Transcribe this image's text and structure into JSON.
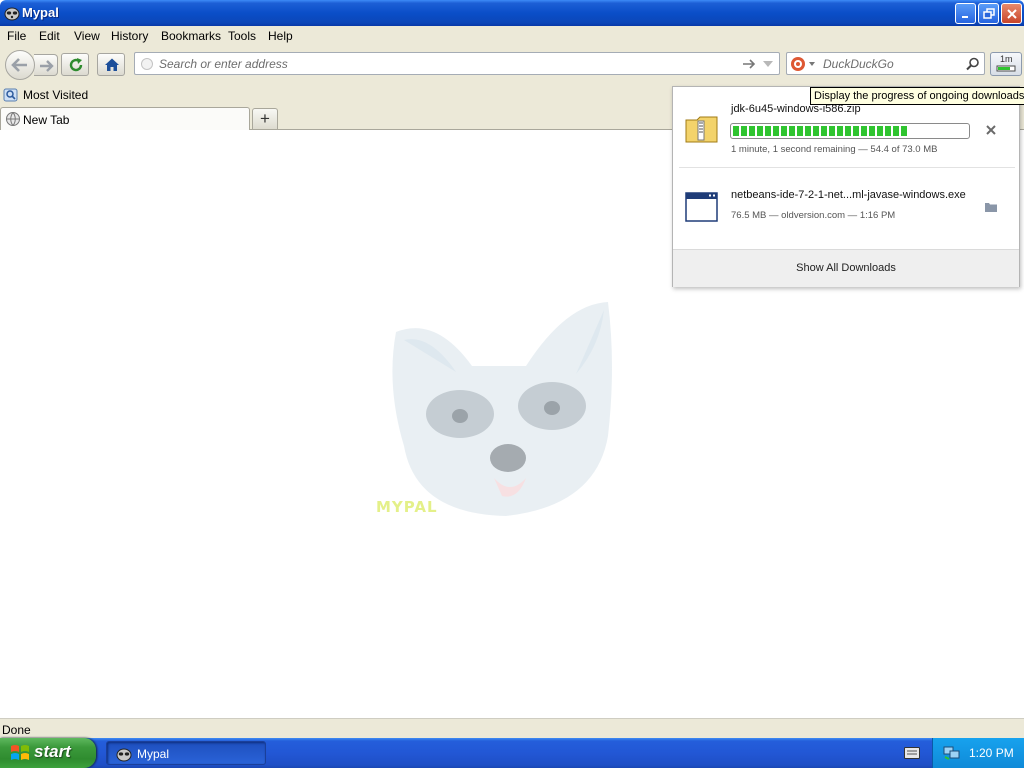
{
  "window": {
    "title": "Mypal"
  },
  "menu": [
    "File",
    "Edit",
    "View",
    "History",
    "Bookmarks",
    "Tools",
    "Help"
  ],
  "navbar": {
    "url_placeholder": "Search or enter address",
    "search_placeholder": "DuckDuckGo",
    "download_time": "1m"
  },
  "bookmarks": [
    {
      "label": "Most Visited"
    }
  ],
  "tabs": [
    {
      "label": "New Tab",
      "active": true
    }
  ],
  "content": {
    "logo_text": "MYPAL"
  },
  "tooltip": "Display the progress of ongoing downloads",
  "downloads": {
    "items": [
      {
        "name": "jdk-6u45-windows-i586.zip",
        "status": "1 minute, 1 second remaining — 54.4 of 73.0 MB",
        "progress": 0.745,
        "icon": "zip-file-icon",
        "action": "cancel"
      },
      {
        "name": "netbeans-ide-7-2-1-net...ml-javase-windows.exe",
        "status": "76.5 MB — oldversion.com — 1:16 PM",
        "icon": "exe-file-icon",
        "action": "open-folder"
      }
    ],
    "show_all_label": "Show All Downloads"
  },
  "statusbar": {
    "text": "Done"
  },
  "taskbar": {
    "start_label": "start",
    "tasks": [
      {
        "label": "Mypal"
      }
    ],
    "clock": "1:20 PM"
  },
  "colors": {
    "titlebar": "#0a4ec8",
    "chrome": "#ece9d8",
    "progress_fill": "#2fc42f",
    "taskbar": "#245edb",
    "start_button": "#3c9a3c",
    "tooltip_bg": "#ffffe1"
  }
}
